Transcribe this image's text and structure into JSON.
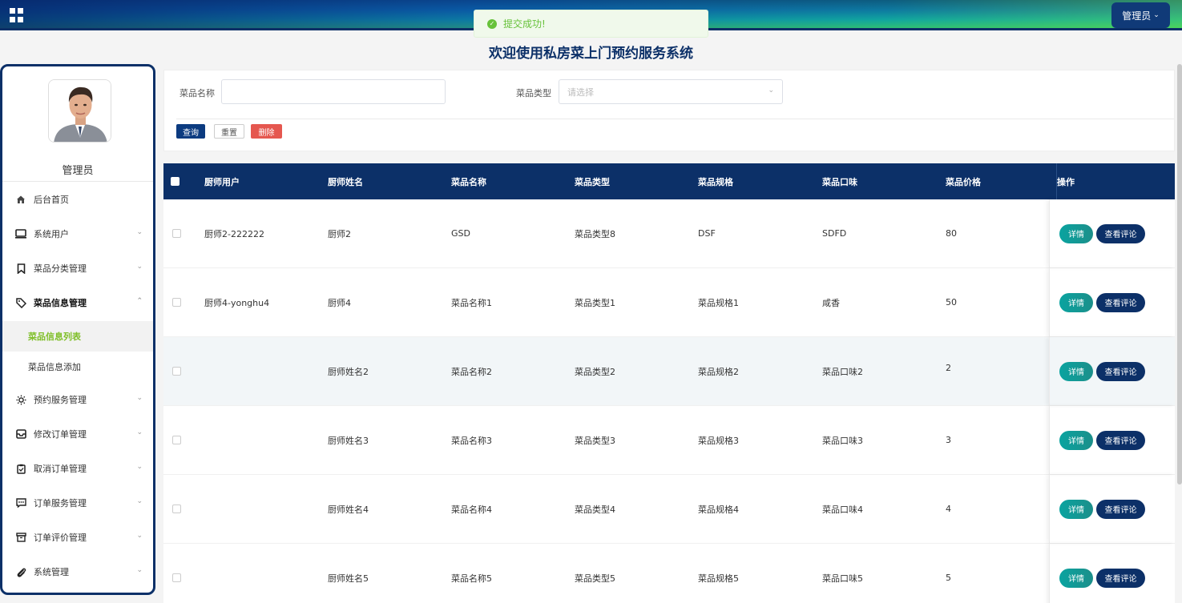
{
  "header": {
    "admin_label": "管理员"
  },
  "toast": {
    "message": "提交成功!"
  },
  "page_title": "欢迎使用私房菜上门预约服务系统",
  "sidebar": {
    "user_name": "管理员",
    "items": [
      {
        "label": "后台首页",
        "icon": "home-icon"
      },
      {
        "label": "系统用户",
        "icon": "monitor-icon"
      },
      {
        "label": "菜品分类管理",
        "icon": "bookmark-icon"
      },
      {
        "label": "菜品信息管理",
        "icon": "tag-icon"
      },
      {
        "label": "预约服务管理",
        "icon": "sun-icon"
      },
      {
        "label": "修改订单管理",
        "icon": "inbox-icon"
      },
      {
        "label": "取消订单管理",
        "icon": "clipboard-icon"
      },
      {
        "label": "订单服务管理",
        "icon": "message-icon"
      },
      {
        "label": "订单评价管理",
        "icon": "box-icon"
      },
      {
        "label": "系统管理",
        "icon": "paperclip-icon"
      }
    ],
    "sub_items": [
      {
        "label": "菜品信息列表"
      },
      {
        "label": "菜品信息添加"
      }
    ]
  },
  "search": {
    "name_label": "菜品名称",
    "name_value": "",
    "type_label": "菜品类型",
    "type_placeholder": "请选择",
    "query_btn": "查询",
    "reset_btn": "重置",
    "delete_btn": "删除"
  },
  "table": {
    "headers": [
      "厨师用户",
      "厨师姓名",
      "菜品名称",
      "菜品类型",
      "菜品规格",
      "菜品口味",
      "菜品价格",
      "操作"
    ],
    "detail_btn": "详情",
    "comment_btn": "查看评论",
    "rows": [
      [
        "厨师2-222222",
        "厨师2",
        "GSD",
        "菜品类型8",
        "DSF",
        "SDFD",
        "80"
      ],
      [
        "厨师4-yonghu4",
        "厨师4",
        "菜品名称1",
        "菜品类型1",
        "菜品规格1",
        "咸香",
        "50"
      ],
      [
        "",
        "厨师姓名2",
        "菜品名称2",
        "菜品类型2",
        "菜品规格2",
        "菜品口味2",
        "2"
      ],
      [
        "",
        "厨师姓名3",
        "菜品名称3",
        "菜品类型3",
        "菜品规格3",
        "菜品口味3",
        "3"
      ],
      [
        "",
        "厨师姓名4",
        "菜品名称4",
        "菜品类型4",
        "菜品规格4",
        "菜品口味4",
        "4"
      ],
      [
        "",
        "厨师姓名5",
        "菜品名称5",
        "菜品类型5",
        "菜品规格5",
        "菜品口味5",
        "5"
      ]
    ]
  }
}
